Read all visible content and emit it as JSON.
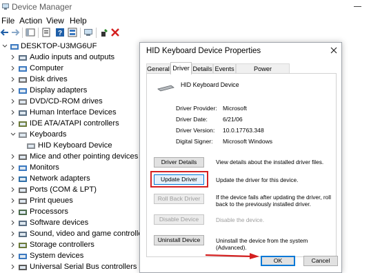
{
  "window": {
    "title": "Device Manager"
  },
  "menu": [
    "File",
    "Action",
    "View",
    "Help"
  ],
  "toolbar": [
    "back-icon",
    "forward-icon",
    "show-hide-console-tree-icon",
    "properties-icon",
    "help-icon",
    "scan-hardware-icon",
    "update-driver-icon",
    "uninstall-icon"
  ],
  "tree": {
    "root": "DESKTOP-U3MG6UF",
    "items": [
      {
        "label": "Audio inputs and outputs",
        "icon": "speaker-icon",
        "expanded": false
      },
      {
        "label": "Computer",
        "icon": "computer-icon",
        "expanded": false
      },
      {
        "label": "Disk drives",
        "icon": "disk-icon",
        "expanded": false
      },
      {
        "label": "Display adapters",
        "icon": "display-icon",
        "expanded": false
      },
      {
        "label": "DVD/CD-ROM drives",
        "icon": "dvd-icon",
        "expanded": false
      },
      {
        "label": "Human Interface Devices",
        "icon": "hid-icon",
        "expanded": false
      },
      {
        "label": "IDE ATA/ATAPI controllers",
        "icon": "ide-icon",
        "expanded": false
      },
      {
        "label": "Keyboards",
        "icon": "keyboard-icon",
        "expanded": true
      },
      {
        "label": "HID Keyboard Device",
        "icon": "keyboard-icon",
        "child": true
      },
      {
        "label": "Mice and other pointing devices",
        "icon": "mouse-icon",
        "expanded": false
      },
      {
        "label": "Monitors",
        "icon": "monitor-icon",
        "expanded": false
      },
      {
        "label": "Network adapters",
        "icon": "network-icon",
        "expanded": false
      },
      {
        "label": "Ports (COM & LPT)",
        "icon": "port-icon",
        "expanded": false
      },
      {
        "label": "Print queues",
        "icon": "printer-icon",
        "expanded": false
      },
      {
        "label": "Processors",
        "icon": "processor-icon",
        "expanded": false
      },
      {
        "label": "Software devices",
        "icon": "software-icon",
        "expanded": false
      },
      {
        "label": "Sound, video and game controllers",
        "icon": "sound-icon",
        "expanded": false
      },
      {
        "label": "Storage controllers",
        "icon": "storage-icon",
        "expanded": false
      },
      {
        "label": "System devices",
        "icon": "system-icon",
        "expanded": false
      },
      {
        "label": "Universal Serial Bus controllers",
        "icon": "usb-icon",
        "expanded": false
      }
    ]
  },
  "dialog": {
    "title": "HID Keyboard Device Properties",
    "tabs": [
      "General",
      "Driver",
      "Details",
      "Events",
      "Power Management"
    ],
    "active_tab": "Driver",
    "device_name": "HID Keyboard Device",
    "props": [
      {
        "label": "Driver Provider:",
        "value": "Microsoft"
      },
      {
        "label": "Driver Date:",
        "value": "6/21/06"
      },
      {
        "label": "Driver Version:",
        "value": "10.0.17763.348"
      },
      {
        "label": "Digital Signer:",
        "value": "Microsoft Windows"
      }
    ],
    "actions": [
      {
        "button": "Driver Details",
        "desc": "View details about the installed driver files.",
        "enabled": true
      },
      {
        "button": "Update Driver",
        "desc": "Update the driver for this device.",
        "enabled": true,
        "highlighted": true
      },
      {
        "button": "Roll Back Driver",
        "desc": "If the device fails after updating the driver, roll back to the previously installed driver.",
        "enabled": false
      },
      {
        "button": "Disable Device",
        "desc": "Disable the device.",
        "enabled": false
      },
      {
        "button": "Uninstall Device",
        "desc": "Uninstall the device from the system (Advanced).",
        "enabled": true
      }
    ],
    "ok_label": "OK",
    "cancel_label": "Cancel"
  },
  "colors": {
    "highlight": "#d42020",
    "focus": "#0078d7",
    "arrow": "#d42020"
  }
}
